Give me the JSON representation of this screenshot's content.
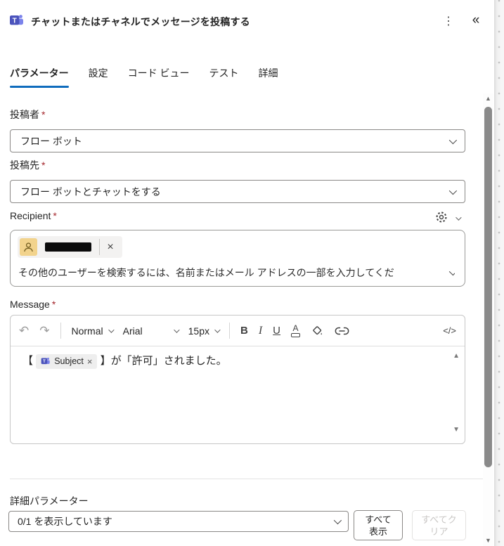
{
  "header": {
    "title": "チャットまたはチャネルでメッセージを投稿する",
    "menu_icon": "⋮",
    "collapse_icon": "«"
  },
  "tabs": {
    "parameters": "パラメーター",
    "settings": "設定",
    "code_view": "コード ビュー",
    "test": "テスト",
    "about": "詳細"
  },
  "fields": {
    "poster": {
      "label": "投稿者",
      "required_mark": "*",
      "value": "フロー ボット"
    },
    "destination": {
      "label": "投稿先",
      "required_mark": "*",
      "value": "フロー ボットとチャットをする"
    },
    "recipient": {
      "label": "Recipient",
      "required_mark": "*",
      "selected_user_redacted": true,
      "remove_label": "×",
      "placeholder": "その他のユーザーを検索するには、名前またはメール アドレスの一部を入力してくだ"
    },
    "message": {
      "label": "Message",
      "required_mark": "*"
    }
  },
  "editor": {
    "toolbar": {
      "undo": "↶",
      "redo": "↷",
      "style": "Normal",
      "font": "Arial",
      "size": "15px",
      "bold": "B",
      "italic": "I",
      "underline": "U",
      "font_color": "A",
      "code": "</>"
    },
    "content": {
      "open_bracket": "【",
      "token": "Subject",
      "token_remove": "×",
      "text": "】が「許可」されました。"
    },
    "scroll_up": "▲",
    "scroll_down": "▼"
  },
  "advanced": {
    "label": "詳細パラメーター",
    "value": "0/1 を表示しています",
    "show_all": {
      "line1": "すべて",
      "line2": "表示"
    },
    "clear_all": {
      "line1": "すべてク",
      "line2": "リア",
      "disabled": true
    }
  },
  "scrollbar": {
    "up": "▲",
    "down": "▼"
  },
  "colors": {
    "accent": "#0f6cbd",
    "teams_purple": "#5059c9",
    "required": "#a4262c"
  }
}
